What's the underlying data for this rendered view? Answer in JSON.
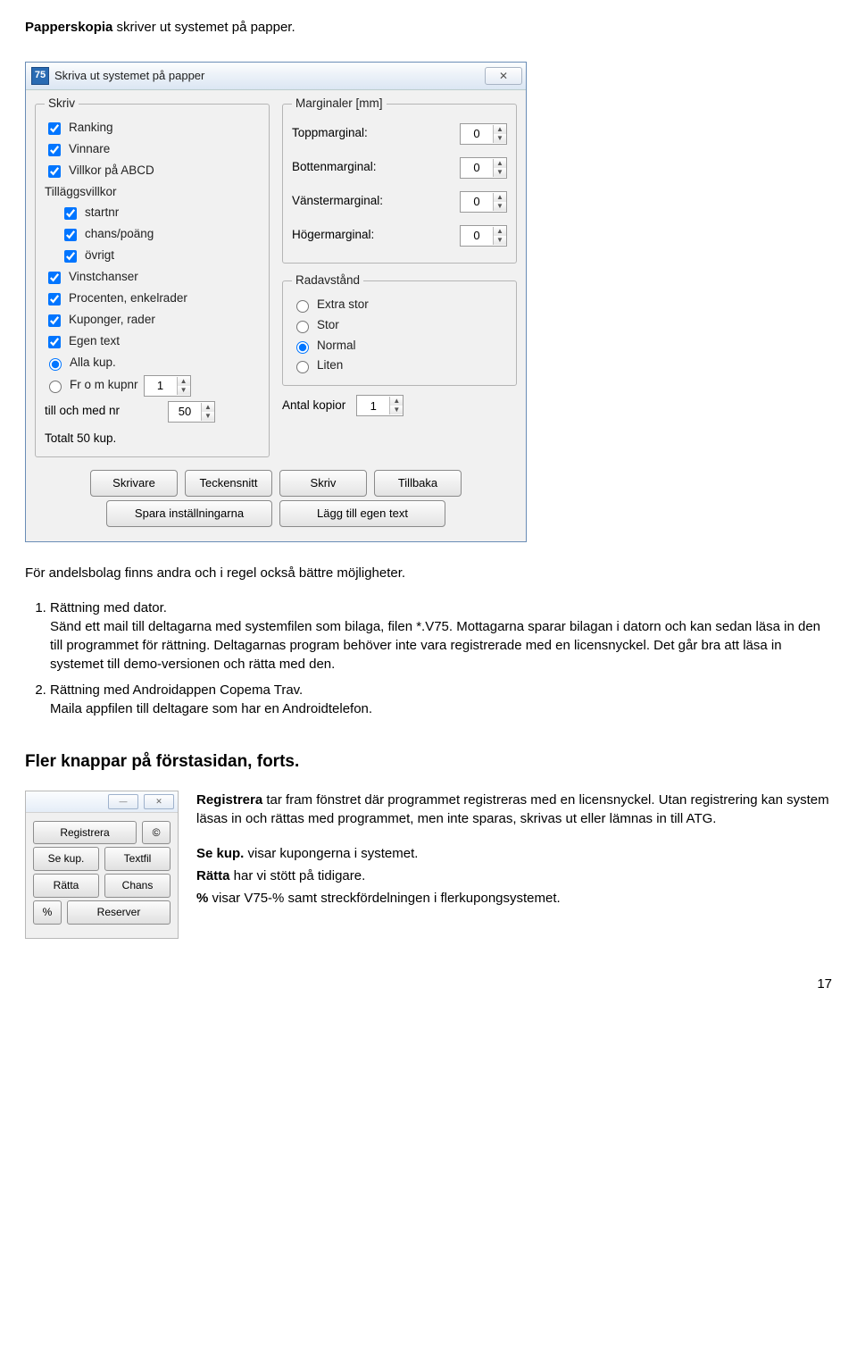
{
  "intro": {
    "bold": "Papperskopia",
    "rest": " skriver ut systemet på papper."
  },
  "dialog": {
    "icon_text": "75",
    "title": "Skriva ut systemet på papper",
    "close_glyph": "✕",
    "skriv_legend": "Skriv",
    "chk": {
      "ranking": "Ranking",
      "vinnare": "Vinnare",
      "villkor": "Villkor på ABCD",
      "tillaggs_header": "Tilläggsvillkor",
      "startnr": "startnr",
      "chans": "chans/poäng",
      "ovrigt": "övrigt",
      "vinstchanser": "Vinstchanser",
      "procenten": "Procenten, enkelrader",
      "kuponger": "Kuponger, rader",
      "egentext": "Egen text"
    },
    "radio_kup": {
      "alla": "Alla kup.",
      "from": "Fr o m kupnr",
      "from_val": "1"
    },
    "till_label": "till och med nr",
    "till_val": "50",
    "totalt": "Totalt 50 kup.",
    "marg_legend": "Marginaler [mm]",
    "marg": {
      "top_label": "Toppmarginal:",
      "top_val": "0",
      "bottom_label": "Bottenmarginal:",
      "bottom_val": "0",
      "left_label": "Vänstermarginal:",
      "left_val": "0",
      "right_label": "Högermarginal:",
      "right_val": "0"
    },
    "radav_legend": "Radavstånd",
    "radav": {
      "extra": "Extra stor",
      "stor": "Stor",
      "normal": "Normal",
      "liten": "Liten"
    },
    "kopior_label": "Antal kopior",
    "kopior_val": "1",
    "buttons": {
      "skrivare": "Skrivare",
      "teckensnitt": "Teckensnitt",
      "skriv": "Skriv",
      "tillbaka": "Tillbaka",
      "spara": "Spara inställningarna",
      "lagg": "Lägg till egen text"
    }
  },
  "body": {
    "p1": "För andelsbolag finns andra och i regel också bättre möjligheter.",
    "li1a": "Rättning med dator.",
    "li1b": "Sänd ett mail till deltagarna med systemfilen som bilaga, filen *.V75. Mottagarna sparar bilagan i datorn och kan sedan läsa in den till programmet för rättning. Deltagarnas program behöver inte vara registrerade med en licensnyckel. Det går bra att läsa in systemet till demo-versionen och rätta med den.",
    "li2a": "Rättning med Androidappen Copema Trav.",
    "li2b": "Maila appfilen till deltagare som har en Androidtelefon."
  },
  "section_heading": "Fler knappar på förstasidan, forts.",
  "mini": {
    "registrera": "Registrera",
    "copyright": "©",
    "sekup": "Se kup.",
    "textfil": "Textfil",
    "ratta": "Rätta",
    "chans": "Chans",
    "percent": "%",
    "reserver": "Reserver"
  },
  "desc": {
    "reg_bold": "Registrera",
    "reg_rest": " tar fram fönstret där programmet registreras med en licensnyckel. Utan registrering kan system läsas in och rättas med programmet, men inte sparas, skrivas ut eller lämnas in till ATG.",
    "sekup_bold": "Se kup.",
    "sekup_rest": " visar kupongerna i systemet.",
    "ratta_bold": "Rätta",
    "ratta_rest": " har vi stött på tidigare.",
    "pct_bold": "%",
    "pct_rest": " visar V75-% samt streckfördelningen i flerkupongsystemet."
  },
  "page_number": "17"
}
